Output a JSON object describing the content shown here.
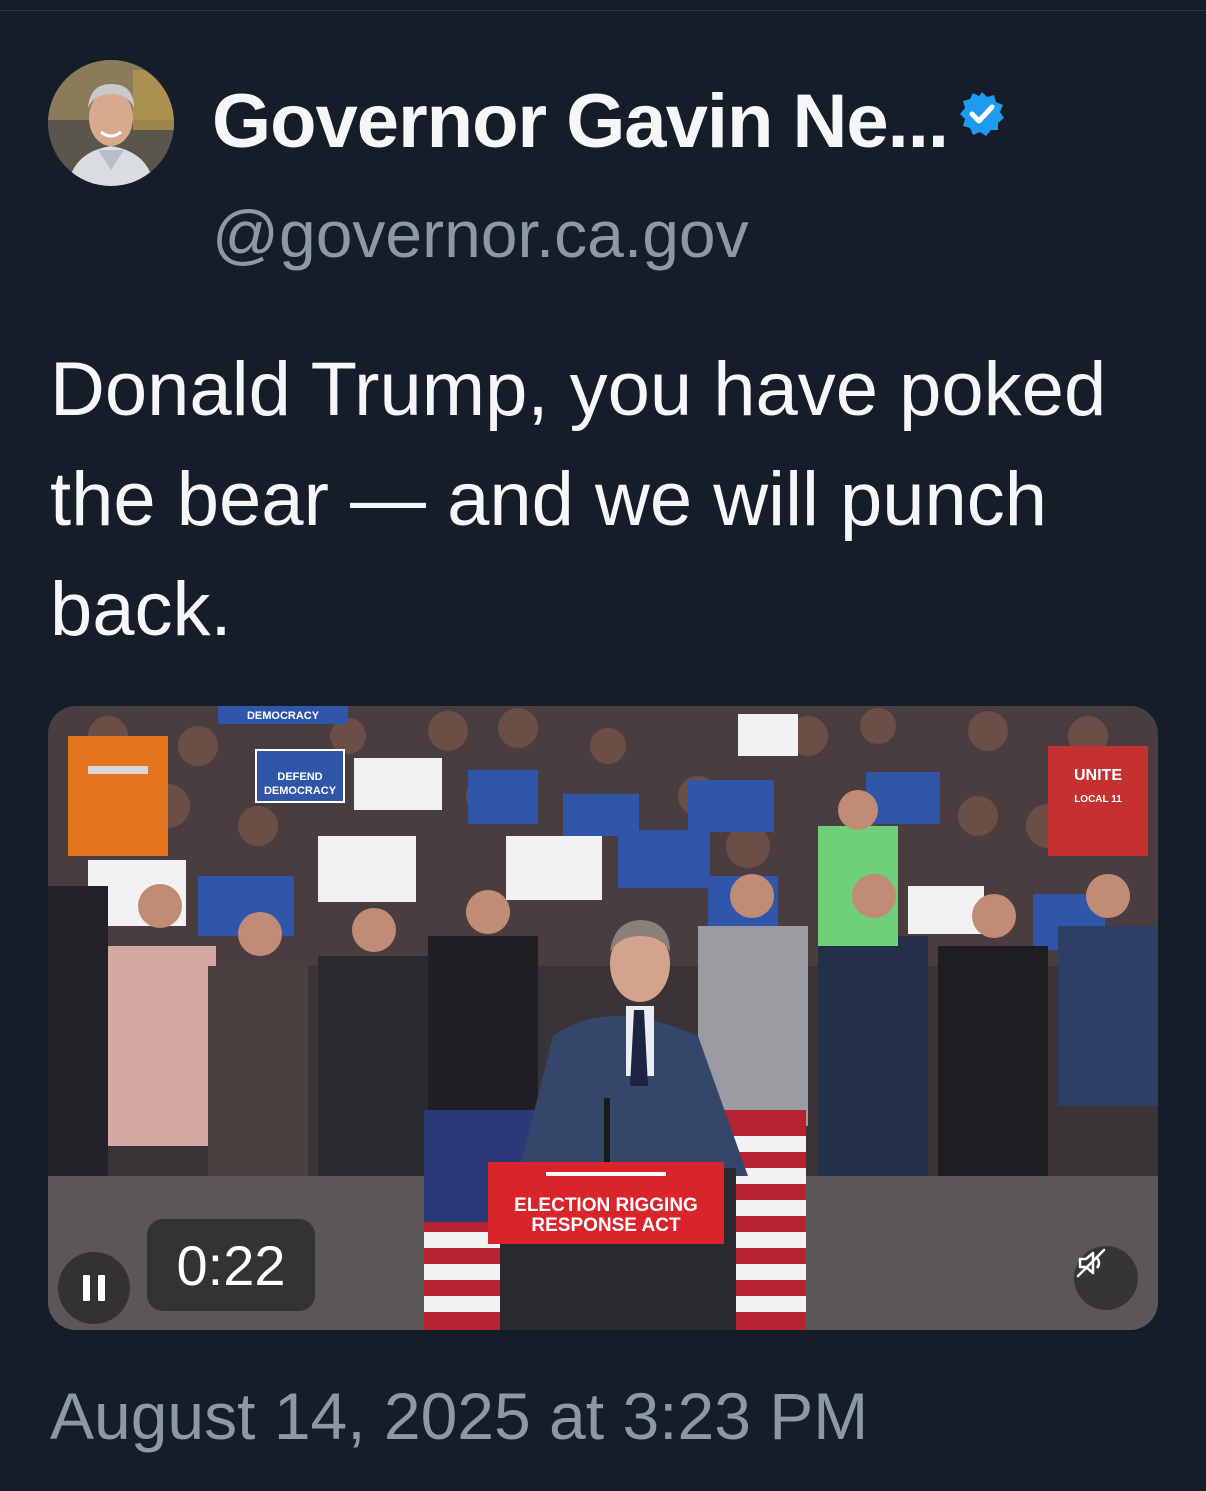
{
  "author": {
    "display_name": "Governor Gavin Ne...",
    "handle": "@governor.ca.gov",
    "verified": true,
    "verified_color": "#1d9bf0"
  },
  "post": {
    "text": "Donald Trump, you have poked the bear — and we will punch back.",
    "timestamp": "August 14, 2025 at 3:23 PM"
  },
  "video": {
    "elapsed": "0:22",
    "playing": true,
    "muted": true,
    "podium_sign_line1": "ELECTION RIGGING",
    "podium_sign_line2": "RESPONSE ACT",
    "crowd_signs": {
      "defend_democracy_1": "DEFEND",
      "defend_democracy_2": "DEMOCRACY",
      "banner_top": "DEMOCRACY",
      "unite_shirt": "UNITE",
      "unite_shirt_sub": "LOCAL 11"
    }
  },
  "colors": {
    "background": "#151d28",
    "text_primary": "#f4f6f8",
    "text_secondary": "#8b98a5",
    "sign_blue": "#2f56a8",
    "podium_red": "#d8242a"
  }
}
